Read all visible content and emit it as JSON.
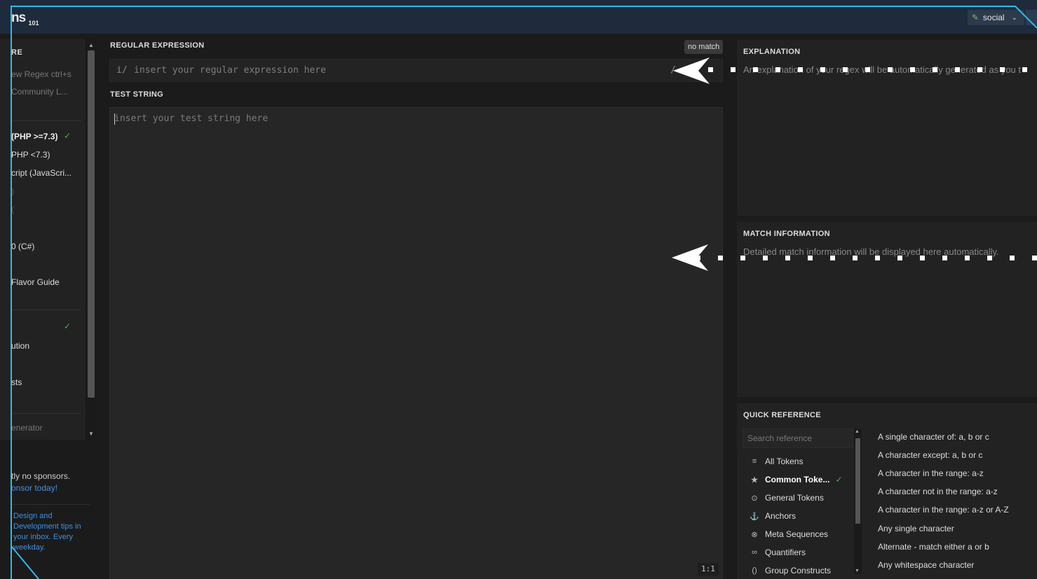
{
  "header": {
    "logo_text": "ns",
    "logo_sub": "101",
    "social_label": "social",
    "social_icon": "wrench-icon"
  },
  "sidebar": {
    "section_title": "RE",
    "items": [
      {
        "label": "ew Regex  ctrl+s"
      },
      {
        "label": " Community L..."
      },
      {
        "label": "(PHP >=7.3)"
      },
      {
        "label": "PHP <7.3)"
      },
      {
        "label": "cript (JavaScri..."
      },
      {
        "label": ")"
      },
      {
        "label": "("
      },
      {
        "label": "0 (C#)"
      },
      {
        "label": "Flavor Guide"
      },
      {
        "label": "ution"
      },
      {
        "label": "sts"
      },
      {
        "label": "enerator"
      }
    ],
    "sponsor_text": "tly no sponsors.",
    "sponsor_link": "onsor today!",
    "ad_text": "Design and Development tips in your inbox. Every weekday."
  },
  "regex": {
    "label": "REGULAR EXPRESSION",
    "delim_start": "i/",
    "placeholder": "insert your regular expression here",
    "delim_end": "/",
    "status": "no match"
  },
  "test": {
    "label": "TEST STRING",
    "placeholder": "insert your test string here",
    "ratio": "1:1"
  },
  "explanation": {
    "title": "EXPLANATION",
    "text": "An explanation of your regex will be automatically generated as you t"
  },
  "match_info": {
    "title": "MATCH INFORMATION",
    "text": "Detailed match information will be displayed here automatically."
  },
  "quick_ref": {
    "title": "QUICK REFERENCE",
    "search_placeholder": "Search reference",
    "categories": [
      {
        "label": "All Tokens",
        "icon": "stack-icon"
      },
      {
        "label": "Common Toke...",
        "icon": "star-icon"
      },
      {
        "label": "General Tokens",
        "icon": "target-icon"
      },
      {
        "label": "Anchors",
        "icon": "anchor-icon"
      },
      {
        "label": "Meta Sequences",
        "icon": "meta-icon"
      },
      {
        "label": "Quantifiers",
        "icon": "quantifier-icon"
      },
      {
        "label": "Group Constructs",
        "icon": "group-icon"
      }
    ],
    "descriptions": [
      "A single character of: a, b or c",
      "A character except: a, b or c",
      "A character in the range: a-z",
      "A character not in the range: a-z",
      "A character in the range: a-z or A-Z",
      "Any single character",
      "Alternate - match either a or b",
      "Any whitespace character"
    ]
  }
}
